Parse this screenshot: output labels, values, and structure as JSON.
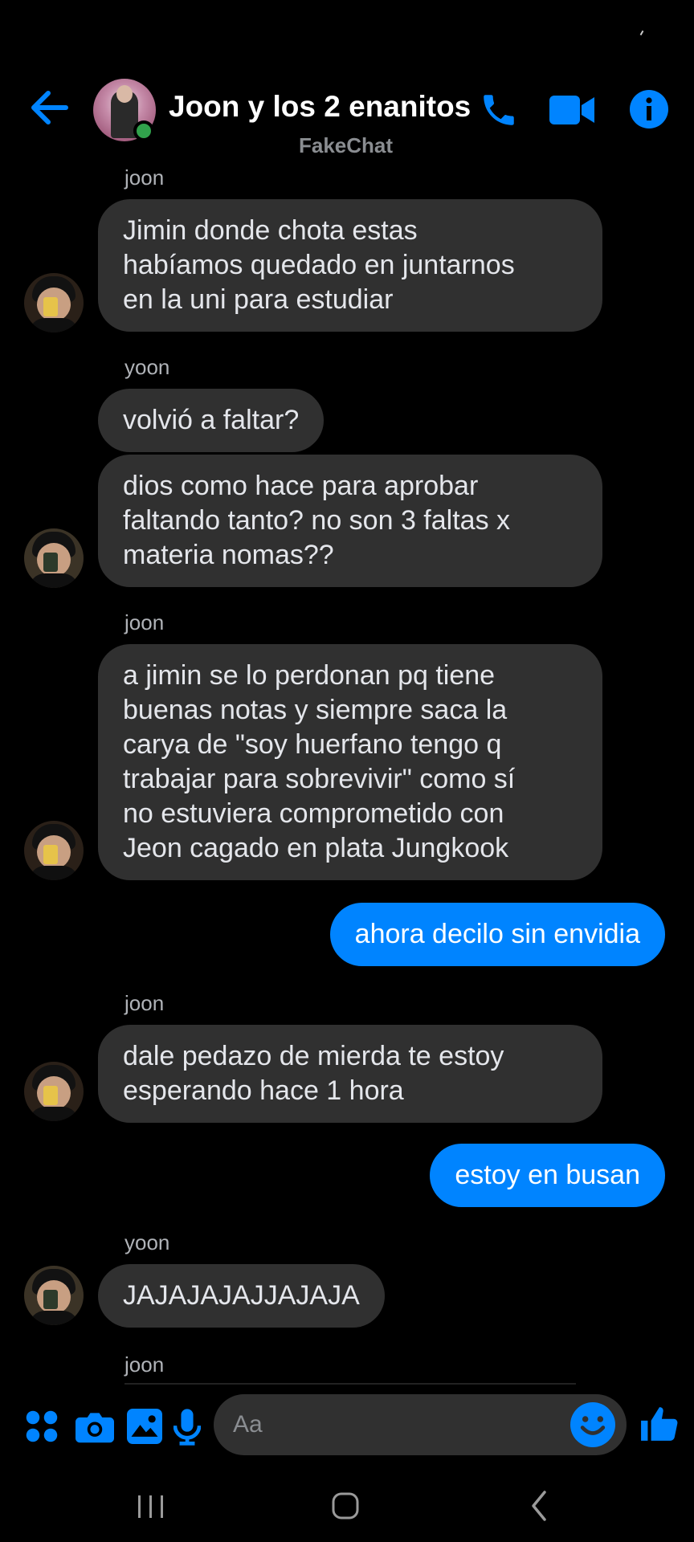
{
  "header": {
    "title": "Joon y los 2 enanitos",
    "subtitle": "FakeChat",
    "accent": "#0084ff",
    "online_color": "#31a24c",
    "icons": [
      "back-arrow-icon",
      "phone-icon",
      "video-camera-icon",
      "info-icon"
    ]
  },
  "messages": [
    {
      "sender": "joon",
      "text": [
        "Jimin donde chota estas",
        "habíamos quedado en juntarnos",
        "en la uni para estudiar"
      ]
    },
    {
      "sender": "yoon",
      "text": [
        "volvió a faltar?"
      ]
    },
    {
      "text": [
        "dios como hace para aprobar",
        "faltando tanto? no son 3 faltas x",
        "materia nomas??"
      ]
    },
    {
      "sender": "joon",
      "text": [
        "a jimin se lo perdonan pq tiene",
        "buenas notas y siempre saca la",
        "carya de \"soy huerfano tengo q",
        "trabajar para sobrevivir\" como sí",
        "no estuviera comprometido con",
        "Jeon cagado en plata Jungkook"
      ]
    },
    {
      "own": true,
      "text": [
        "ahora decilo sin envidia"
      ]
    },
    {
      "sender": "joon",
      "text": [
        "dale pedazo de mierda te estoy",
        "esperando hace 1 hora"
      ]
    },
    {
      "own": true,
      "text": [
        "estoy en busan"
      ]
    },
    {
      "sender": "yoon",
      "text": [
        "JAJAJAJAJJAJAJA"
      ]
    },
    {
      "sender": "joon",
      "text": []
    }
  ],
  "composer": {
    "placeholder": "Aa",
    "icons": [
      "apps-grid-icon",
      "camera-icon",
      "gallery-icon",
      "microphone-icon",
      "emoji-icon",
      "thumbs-up-icon"
    ]
  },
  "nav": {
    "icons": [
      "recent-apps-icon",
      "home-icon",
      "back-icon"
    ]
  }
}
